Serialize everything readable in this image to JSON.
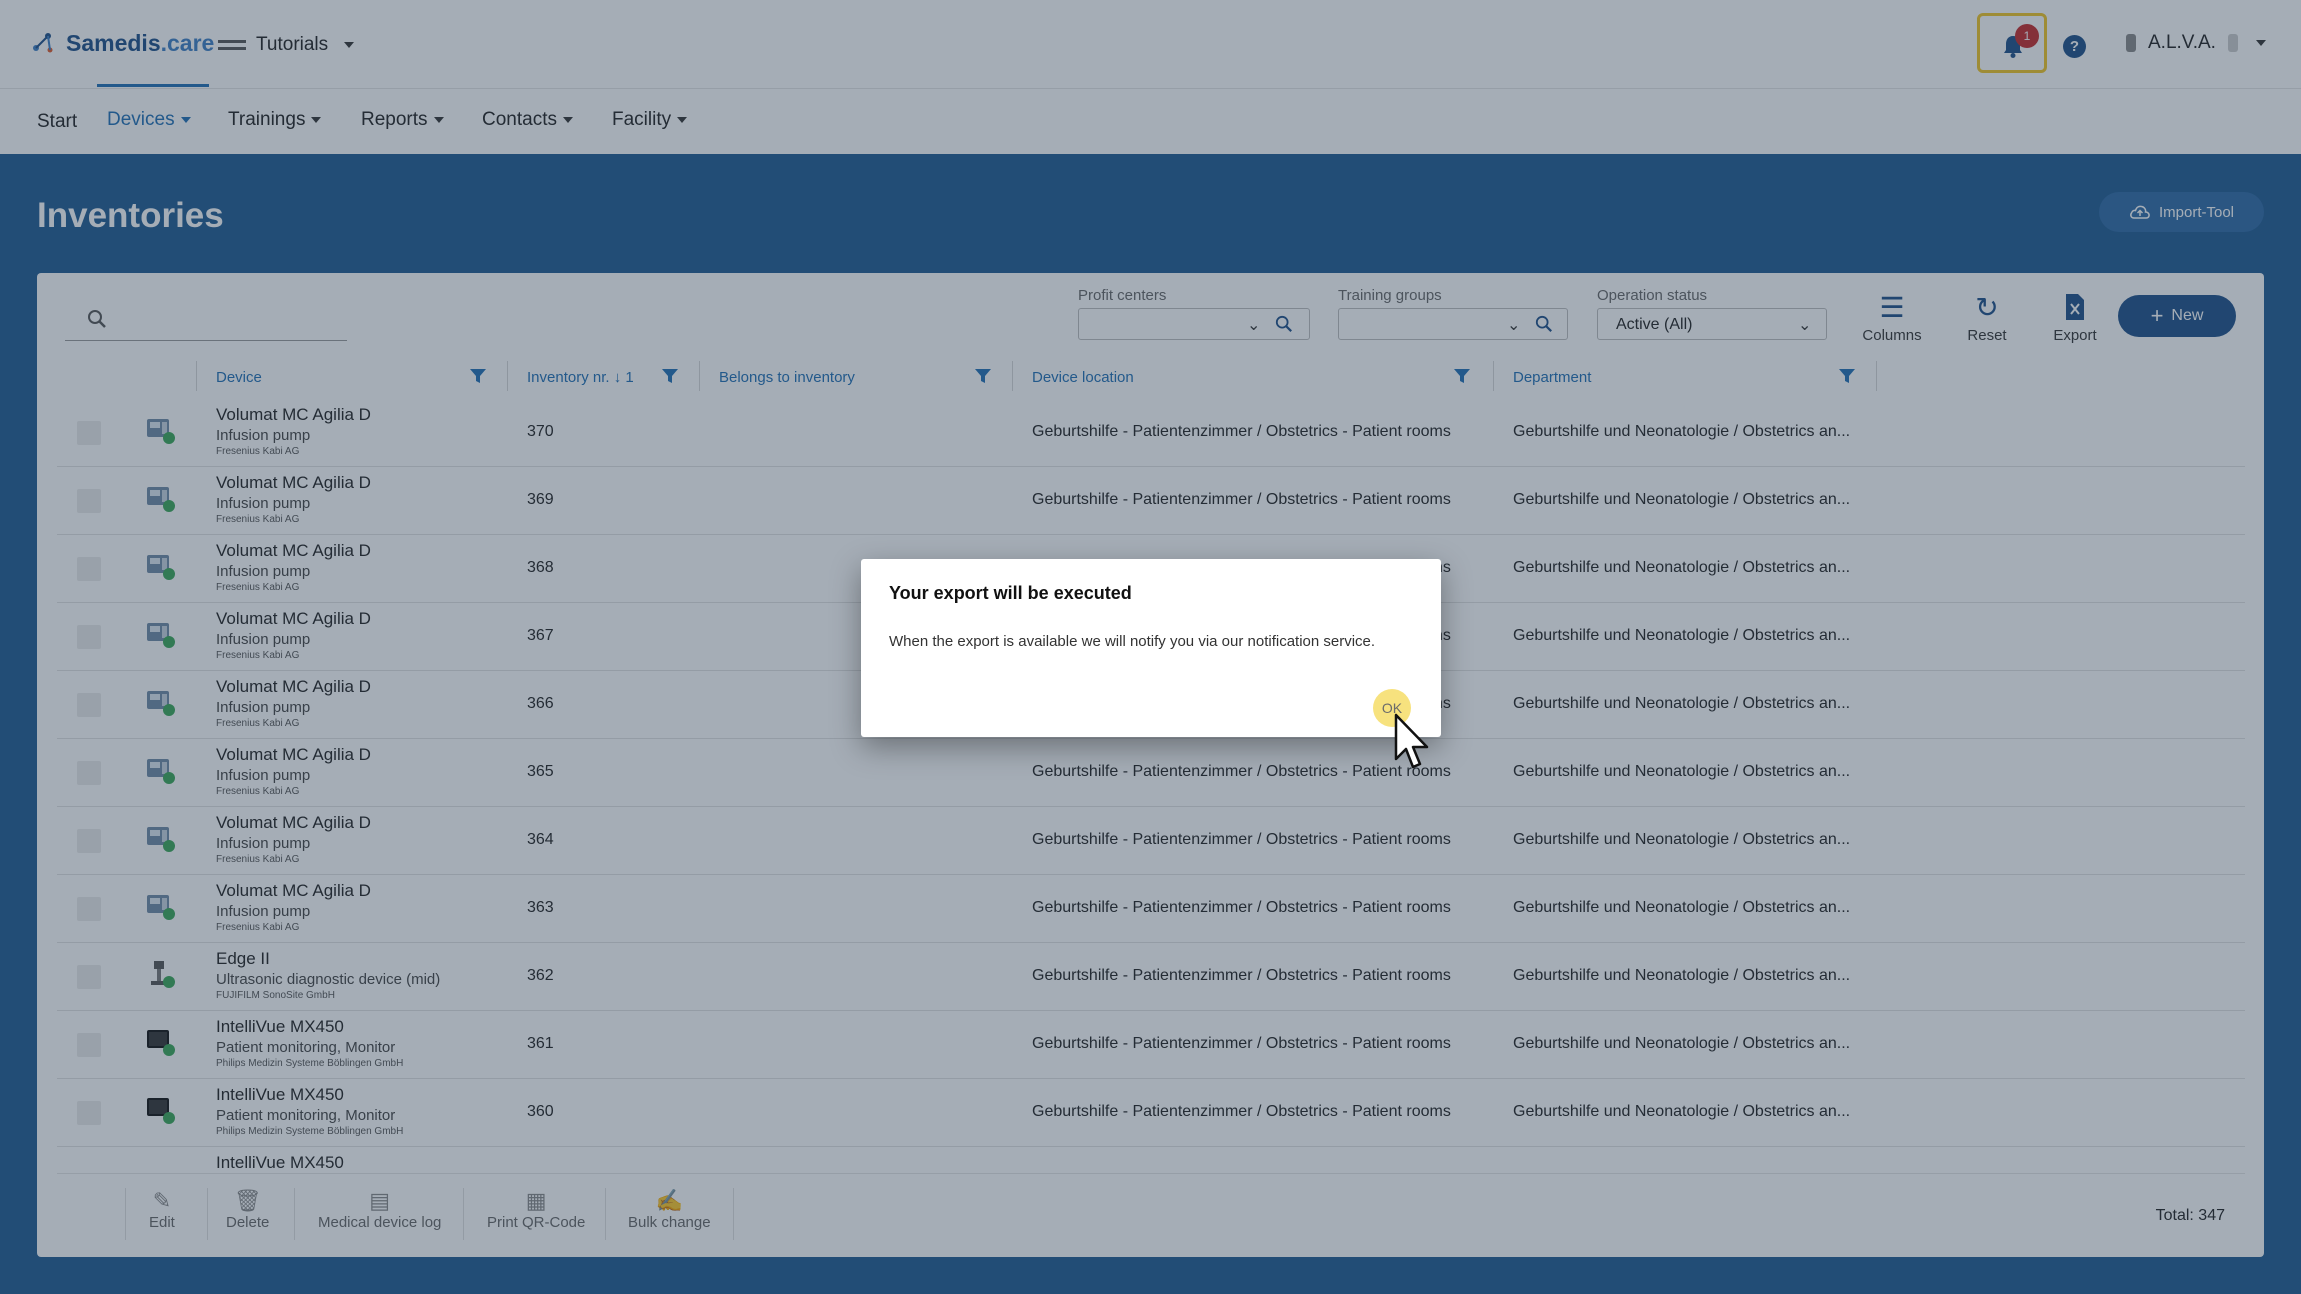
{
  "header": {
    "brand_main": "Samedis",
    "brand_suffix": ".care",
    "tenant": "Tutorials",
    "notification_count": "1",
    "help_icon": "?",
    "user": "A.L.V.A."
  },
  "nav": {
    "start": "Start",
    "devices": "Devices",
    "trainings": "Trainings",
    "reports": "Reports",
    "contacts": "Contacts",
    "facility": "Facility"
  },
  "page": {
    "title": "Inventories",
    "import_tool": "Import-Tool"
  },
  "toolbar": {
    "profit_centers_label": "Profit centers",
    "training_groups_label": "Training groups",
    "operation_status_label": "Operation status",
    "operation_status_value": "Active (All)",
    "columns": "Columns",
    "reset": "Reset",
    "export": "Export",
    "new": "New"
  },
  "table": {
    "headers": {
      "device": "Device",
      "inventory_nr": "Inventory nr.",
      "sort_index": "1",
      "belongs_to": "Belongs to inventory",
      "location": "Device location",
      "department": "Department"
    },
    "rows": [
      {
        "name": "Volumat MC Agilia D",
        "type": "Infusion pump",
        "maker": "Fresenius Kabi AG",
        "inv": "370",
        "loc": "Geburtshilfe - Patientenzimmer / Obstetrics - Patient rooms",
        "dep": "Geburtshilfe und Neonatologie / Obstetrics an...",
        "thumb": "pump"
      },
      {
        "name": "Volumat MC Agilia D",
        "type": "Infusion pump",
        "maker": "Fresenius Kabi AG",
        "inv": "369",
        "loc": "Geburtshilfe - Patientenzimmer / Obstetrics - Patient rooms",
        "dep": "Geburtshilfe und Neonatologie / Obstetrics an...",
        "thumb": "pump"
      },
      {
        "name": "Volumat MC Agilia D",
        "type": "Infusion pump",
        "maker": "Fresenius Kabi AG",
        "inv": "368",
        "loc": "Geburtshilfe - Patientenzimmer / Obstetrics - Patient rooms",
        "dep": "Geburtshilfe und Neonatologie / Obstetrics an...",
        "thumb": "pump"
      },
      {
        "name": "Volumat MC Agilia D",
        "type": "Infusion pump",
        "maker": "Fresenius Kabi AG",
        "inv": "367",
        "loc": "Geburtshilfe - Patientenzimmer / Obstetrics - Patient rooms",
        "dep": "Geburtshilfe und Neonatologie / Obstetrics an...",
        "thumb": "pump"
      },
      {
        "name": "Volumat MC Agilia D",
        "type": "Infusion pump",
        "maker": "Fresenius Kabi AG",
        "inv": "366",
        "loc": "Geburtshilfe - Patientenzimmer / Obstetrics - Patient rooms",
        "dep": "Geburtshilfe und Neonatologie / Obstetrics an...",
        "thumb": "pump"
      },
      {
        "name": "Volumat MC Agilia D",
        "type": "Infusion pump",
        "maker": "Fresenius Kabi AG",
        "inv": "365",
        "loc": "Geburtshilfe - Patientenzimmer / Obstetrics - Patient rooms",
        "dep": "Geburtshilfe und Neonatologie / Obstetrics an...",
        "thumb": "pump"
      },
      {
        "name": "Volumat MC Agilia D",
        "type": "Infusion pump",
        "maker": "Fresenius Kabi AG",
        "inv": "364",
        "loc": "Geburtshilfe - Patientenzimmer / Obstetrics - Patient rooms",
        "dep": "Geburtshilfe und Neonatologie / Obstetrics an...",
        "thumb": "pump"
      },
      {
        "name": "Volumat MC Agilia D",
        "type": "Infusion pump",
        "maker": "Fresenius Kabi AG",
        "inv": "363",
        "loc": "Geburtshilfe - Patientenzimmer / Obstetrics - Patient rooms",
        "dep": "Geburtshilfe und Neonatologie / Obstetrics an...",
        "thumb": "pump"
      },
      {
        "name": "Edge II",
        "type": "Ultrasonic diagnostic device (mid)",
        "maker": "FUJIFILM SonoSite GmbH",
        "inv": "362",
        "loc": "Geburtshilfe - Patientenzimmer / Obstetrics - Patient rooms",
        "dep": "Geburtshilfe und Neonatologie / Obstetrics an...",
        "thumb": "ultrasound"
      },
      {
        "name": "IntelliVue MX450",
        "type": "Patient monitoring, Monitor",
        "maker": "Philips Medizin Systeme Böblingen GmbH",
        "inv": "361",
        "loc": "Geburtshilfe - Patientenzimmer / Obstetrics - Patient rooms",
        "dep": "Geburtshilfe und Neonatologie / Obstetrics an...",
        "thumb": "monitor"
      },
      {
        "name": "IntelliVue MX450",
        "type": "Patient monitoring, Monitor",
        "maker": "Philips Medizin Systeme Böblingen GmbH",
        "inv": "360",
        "loc": "Geburtshilfe - Patientenzimmer / Obstetrics - Patient rooms",
        "dep": "Geburtshilfe und Neonatologie / Obstetrics an...",
        "thumb": "monitor"
      },
      {
        "name": "IntelliVue MX450",
        "type": "",
        "maker": "",
        "inv": "",
        "loc": "",
        "dep": "",
        "thumb": ""
      }
    ]
  },
  "actions": {
    "edit": "Edit",
    "delete": "Delete",
    "device_log": "Medical device log",
    "print_qr": "Print QR-Code",
    "bulk_change": "Bulk change",
    "total": "Total: 347"
  },
  "dialog": {
    "title": "Your export will be executed",
    "message": "When the export is available we will notify you via our notification service.",
    "ok": "OK"
  },
  "colors": {
    "primary": "#1c4f88",
    "link": "#1f6fb5",
    "highlight": "#f3c623",
    "badge": "#c62828"
  }
}
